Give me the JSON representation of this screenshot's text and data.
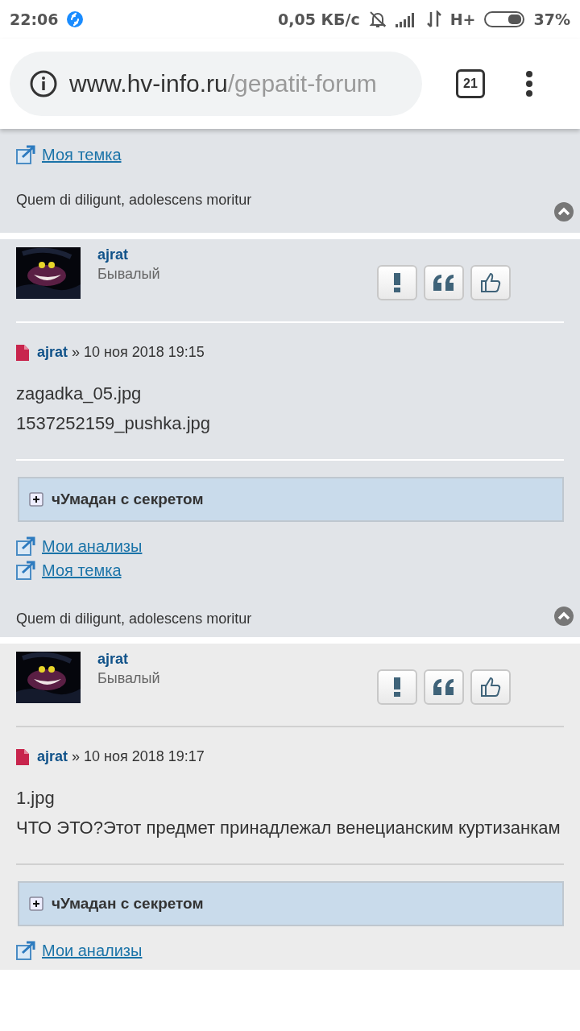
{
  "status_bar": {
    "time": "22:06",
    "speed": "0,05 КБ/с",
    "network": "H+",
    "battery": "37%"
  },
  "browser": {
    "url_host": "www.hv-info.ru",
    "url_path": "/gepatit-forum",
    "tab_count": "21"
  },
  "previous_post_tail": {
    "links": [
      "Моя темка"
    ],
    "signature": "Quem di diligunt, adolescens moritur"
  },
  "posts": [
    {
      "author": "ajrat",
      "rank": "Бывалый",
      "meta_author": "ajrat",
      "date": "» 10 ноя 2018 19:15",
      "body": [
        "zagadka_05.jpg",
        "1537252159_pushka.jpg"
      ],
      "spoiler": "чУмадан с секретом",
      "links": [
        "Мои анализы",
        "Моя темка"
      ],
      "signature": "Quem di diligunt, adolescens moritur"
    },
    {
      "author": "ajrat",
      "rank": "Бывалый",
      "meta_author": "ajrat",
      "date": "» 10 ноя 2018 19:17",
      "body": [
        "1.jpg",
        "ЧТО ЭТО?Этот предмет принадлежал венецианским куртизанкам"
      ],
      "spoiler": "чУмадан с секретом",
      "links": [
        "Мои анализы"
      ]
    }
  ]
}
